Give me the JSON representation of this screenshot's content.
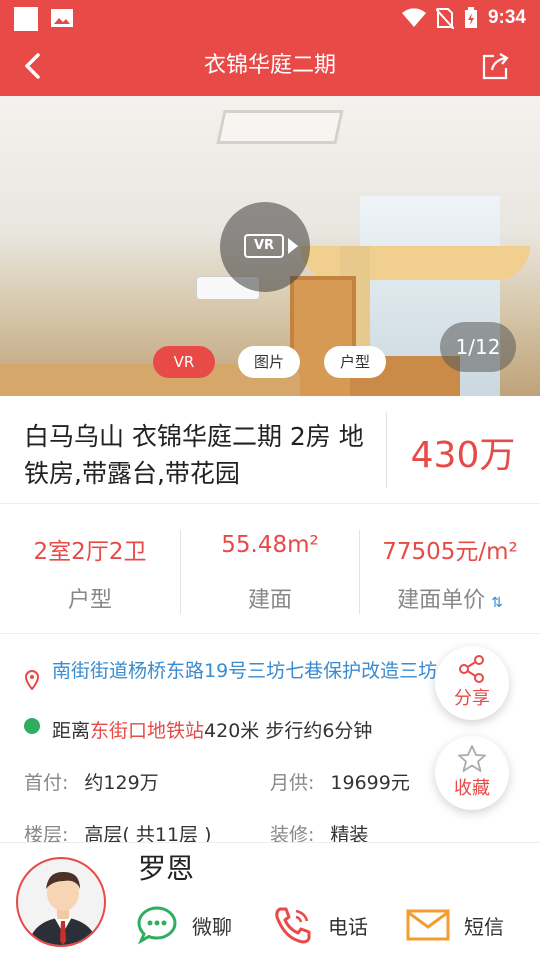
{
  "status_bar": {
    "time": "9:34"
  },
  "appbar": {
    "title": "衣锦华庭二期"
  },
  "hero": {
    "vr_badge": "VR",
    "tabs": [
      "VR",
      "图片",
      "户型"
    ],
    "active_tab": "VR",
    "counter": "1/12"
  },
  "listing": {
    "title": "白马乌山 衣锦华庭二期 2房 地铁房,带露台,带花园",
    "price": "430万"
  },
  "stats": [
    {
      "value": "2室2厅2卫",
      "label": "户型"
    },
    {
      "value": "55.48m²",
      "label": "建面"
    },
    {
      "value": "77505元/m²",
      "label": "建面单价"
    }
  ],
  "info": {
    "address": "南街街道杨桥东路19号三坊七巷保护改造三坊",
    "metro_prefix": "距离",
    "metro_station": "东街口地铁站",
    "metro_suffix": "420米 步行约6分钟",
    "rows": [
      {
        "label": "首付:",
        "value": "约129万"
      },
      {
        "label": "月供:",
        "value": "19699元"
      },
      {
        "label": "楼层:",
        "value": "高层( 共11层 )"
      },
      {
        "label": "装修:",
        "value": "精装"
      }
    ]
  },
  "fabs": {
    "share": "分享",
    "favorite": "收藏"
  },
  "agent": {
    "name": "罗恩",
    "actions": [
      {
        "label": "微聊",
        "icon": "chat-icon"
      },
      {
        "label": "电话",
        "icon": "phone-icon"
      },
      {
        "label": "短信",
        "icon": "mail-icon"
      }
    ]
  },
  "colors": {
    "accent": "#e84a47",
    "link": "#3a8bd0",
    "metro": "#2fae62"
  }
}
